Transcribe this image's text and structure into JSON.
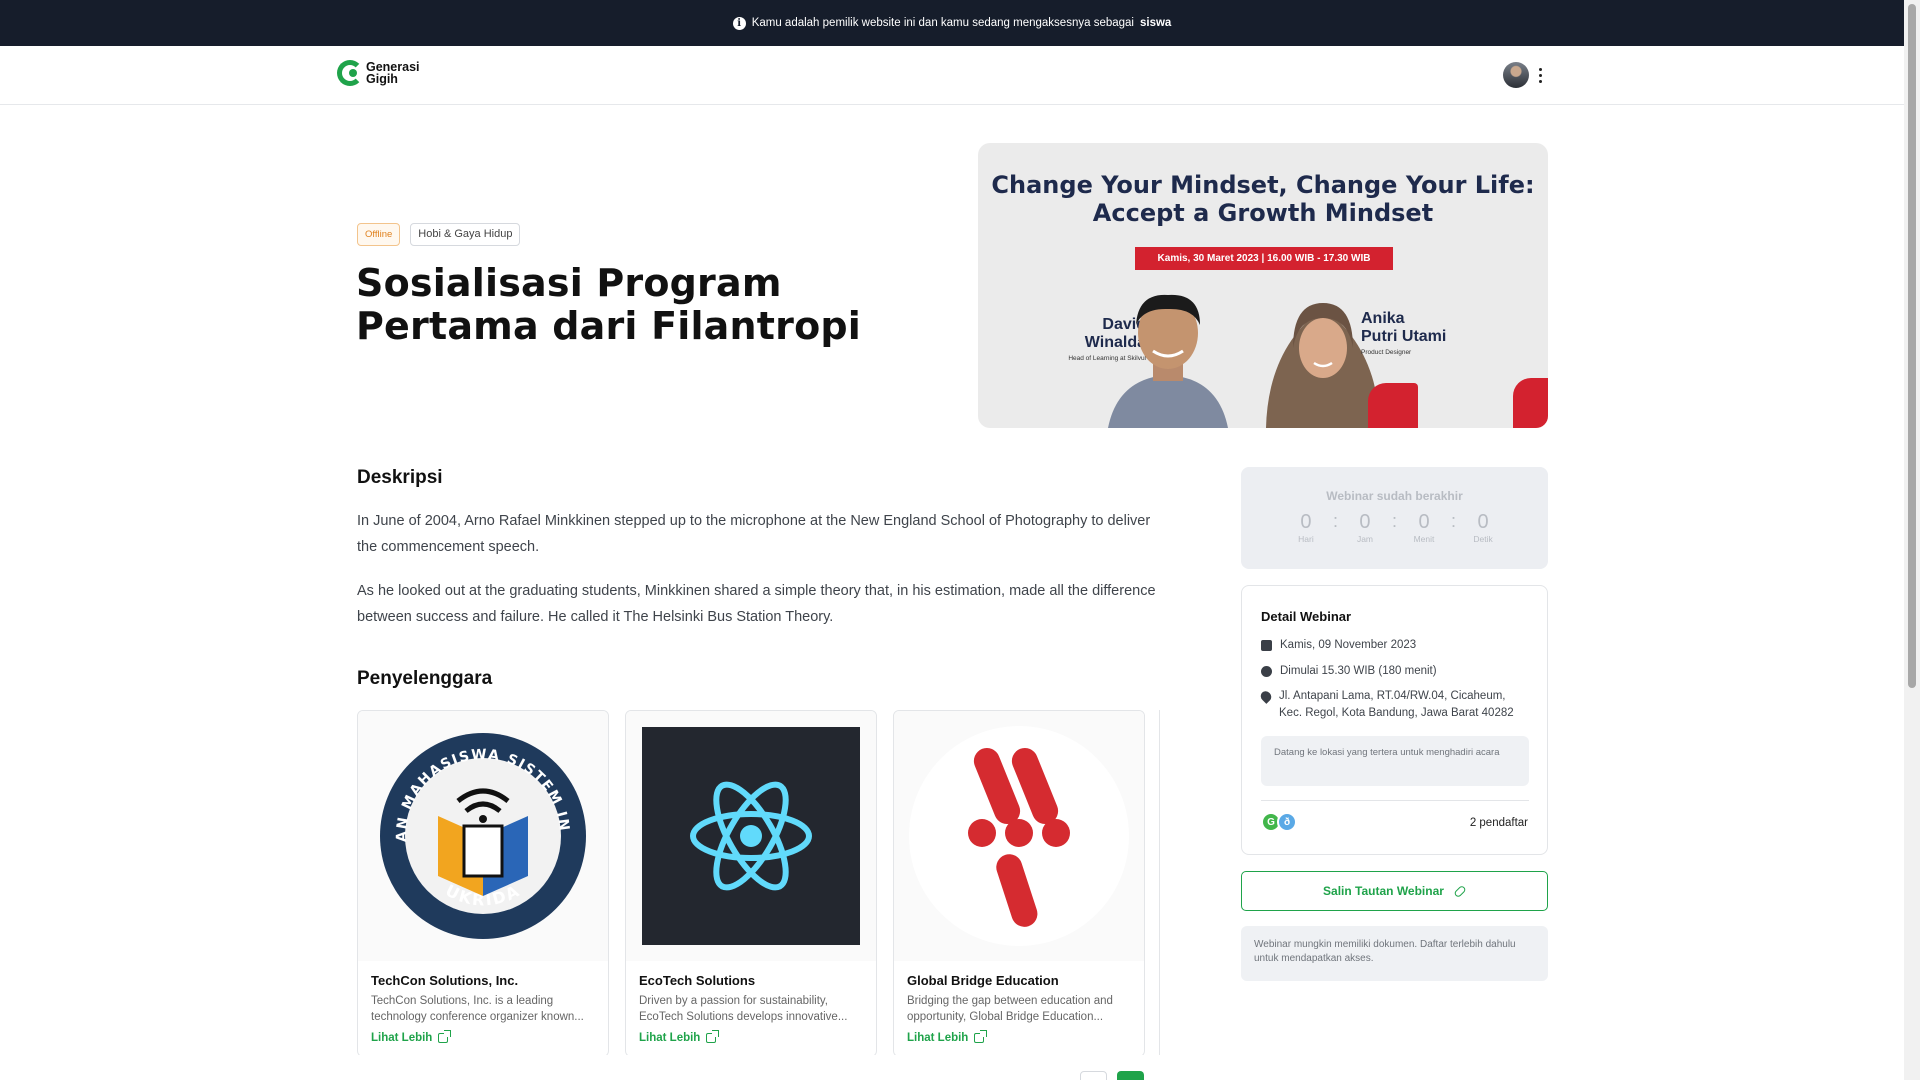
{
  "notice": {
    "text": "Kamu adalah pemilik website ini dan kamu sedang mengaksesnya sebagai",
    "role": "siswa"
  },
  "brand": {
    "line1": "Generasi",
    "line2": "Gigih",
    "color": "#1fa34a"
  },
  "event": {
    "tags": [
      "Offline",
      "Hobi & Gaya Hidup"
    ],
    "title": "Sosialisasi Program Pertama dari Filantropi",
    "banner": {
      "title": "Change Your Mindset, Change Your Life: Accept a Growth Mindset",
      "date": "Kamis, 30 Maret 2023 | 16.00 WIB - 17.30 WIB",
      "speaker1": {
        "name_first": "David",
        "name_last": "Winalda",
        "role": "Head of Learning at Skilvul"
      },
      "speaker2": {
        "name_first": "Anika",
        "name_last": "Putri Utami",
        "role": "Product Designer"
      }
    }
  },
  "description": {
    "heading": "Deskripsi",
    "paragraphs": [
      "In June of 2004, Arno Rafael Minkkinen stepped up to the microphone at the New England School of Photography to deliver the commencement speech.",
      "As he looked out at the graduating students, Minkkinen shared a simple theory that, in his estimation, made all the difference between success and failure. He called it The Helsinki Bus Station Theory."
    ]
  },
  "organizers": {
    "heading": "Penyelenggara",
    "more_label": "Lihat Lebih",
    "items": [
      {
        "name": "TechCon Solutions, Inc.",
        "bio": "TechCon Solutions, Inc. is a leading technology conference organizer known...",
        "logo_text": "HIMPUNAN MAHASISWA SISTEM INFORMASI",
        "logo_bottom": "UKRIDA"
      },
      {
        "name": "EcoTech Solutions",
        "bio": "Driven by a passion for sustainability, EcoTech Solutions develops innovative..."
      },
      {
        "name": "Global Bridge Education",
        "bio": "Bridging the gap between education and opportunity, Global Bridge Education..."
      }
    ]
  },
  "countdown": {
    "title": "Webinar sudah berakhir",
    "units": [
      {
        "value": "0",
        "label": "Hari"
      },
      {
        "value": "0",
        "label": "Jam"
      },
      {
        "value": "0",
        "label": "Menit"
      },
      {
        "value": "0",
        "label": "Detik"
      }
    ]
  },
  "details": {
    "heading": "Detail Webinar",
    "date": "Kamis, 09 November 2023",
    "time": "Dimulai 15.30 WIB (180 menit)",
    "location": "Jl. Antapani Lama, RT.04/RW.04, Cicaheum, Kec. Regol, Kota Bandung, Jawa Barat 40282",
    "note": "Datang ke lokasi yang tertera untuk menghadiri acara",
    "avatars": [
      "G",
      "ð"
    ],
    "registrants": "2 pendaftar"
  },
  "copy_button": "Salin Tautan Webinar",
  "doc_note": "Webinar mungkin memiliki dokumen. Daftar terlebih dahulu untuk mendapatkan akses."
}
